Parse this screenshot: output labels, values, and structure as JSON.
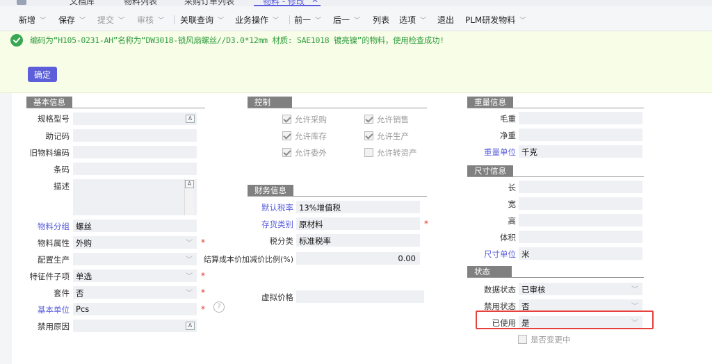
{
  "tabs": [
    {
      "label": "文档库"
    },
    {
      "label": "物料列表"
    },
    {
      "label": "采购订单列表"
    },
    {
      "label": "物料 - 修改",
      "close": "✕"
    }
  ],
  "toolbar": {
    "items": [
      {
        "label": "新增",
        "caret": "﹀"
      },
      {
        "label": "保存",
        "caret": "﹀"
      },
      {
        "label": "提交",
        "caret": "﹀"
      },
      {
        "label": "审核",
        "caret": "﹀"
      },
      {
        "label": "关联查询",
        "caret": "﹀"
      },
      {
        "label": "业务操作",
        "caret": "﹀"
      },
      {
        "label": "前一",
        "caret": "﹀"
      },
      {
        "label": "后一",
        "caret": "﹀"
      },
      {
        "label": "列表"
      },
      {
        "label": "选项",
        "caret": "﹀"
      },
      {
        "label": "退出"
      },
      {
        "label": "PLM研发物料",
        "caret": "﹀"
      }
    ]
  },
  "notice": {
    "message": "编码为“H105-0231-AH”名称为“DW3018-锁风扇螺丝//D3.0*12mm 材质: SAE1018 镀亮镍”的物料，使用检查成功!",
    "confirm_label": "确定"
  },
  "basic_info": {
    "title": "基本信息",
    "spec_label": "规格型号",
    "mnemonic_label": "助记码",
    "old_code_label": "旧物料编码",
    "barcode_label": "条码",
    "desc_label": "描述",
    "group_label": "物料分组",
    "group_value": "螺丝",
    "attr_label": "物料属性",
    "attr_value": "外购",
    "config_label": "配置生产",
    "feature_label": "特征件子项",
    "feature_value": "单选",
    "kit_label": "套件",
    "kit_value": "否",
    "unit_label": "基本单位",
    "unit_value": "Pcs",
    "disable_reason_label": "禁用原因",
    "settle_label": "结算成本价加减价比例(%)",
    "settle_value": "0.00",
    "virtual_price_label": "虚拟价格",
    "text_icon": "A",
    "help_icon": "?"
  },
  "control": {
    "title": "控制",
    "allow_purchase": "允许采购",
    "allow_sale": "允许销售",
    "allow_stock": "允许库存",
    "allow_produce": "允许生产",
    "allow_outsource": "允许委外",
    "allow_asset": "允许转资产"
  },
  "finance": {
    "title": "财务信息",
    "tax_rate_label": "默认税率",
    "tax_rate_value": "13%增值税",
    "stock_type_label": "存货类别",
    "stock_type_value": "原材料",
    "tax_class_label": "税分类",
    "tax_class_value": "标准税率"
  },
  "weight": {
    "title": "重量信息",
    "gross_label": "毛重",
    "net_label": "净重",
    "unit_label": "重量单位",
    "unit_value": "千克"
  },
  "size": {
    "title": "尺寸信息",
    "length_label": "长",
    "width_label": "宽",
    "height_label": "高",
    "volume_label": "体积",
    "unit_label": "尺寸单位",
    "unit_value": "米"
  },
  "status": {
    "title": "状态",
    "data_status_label": "数据状态",
    "data_status_value": "已审核",
    "forbid_status_label": "禁用状态",
    "forbid_status_value": "否",
    "used_label": "已使用",
    "used_value": "是",
    "changing_label": "是否变更中"
  },
  "colors": {
    "accent": "#5c5fd9",
    "success": "#2f9d3d",
    "required": "#e0352b",
    "highlight": "#e8403a"
  }
}
